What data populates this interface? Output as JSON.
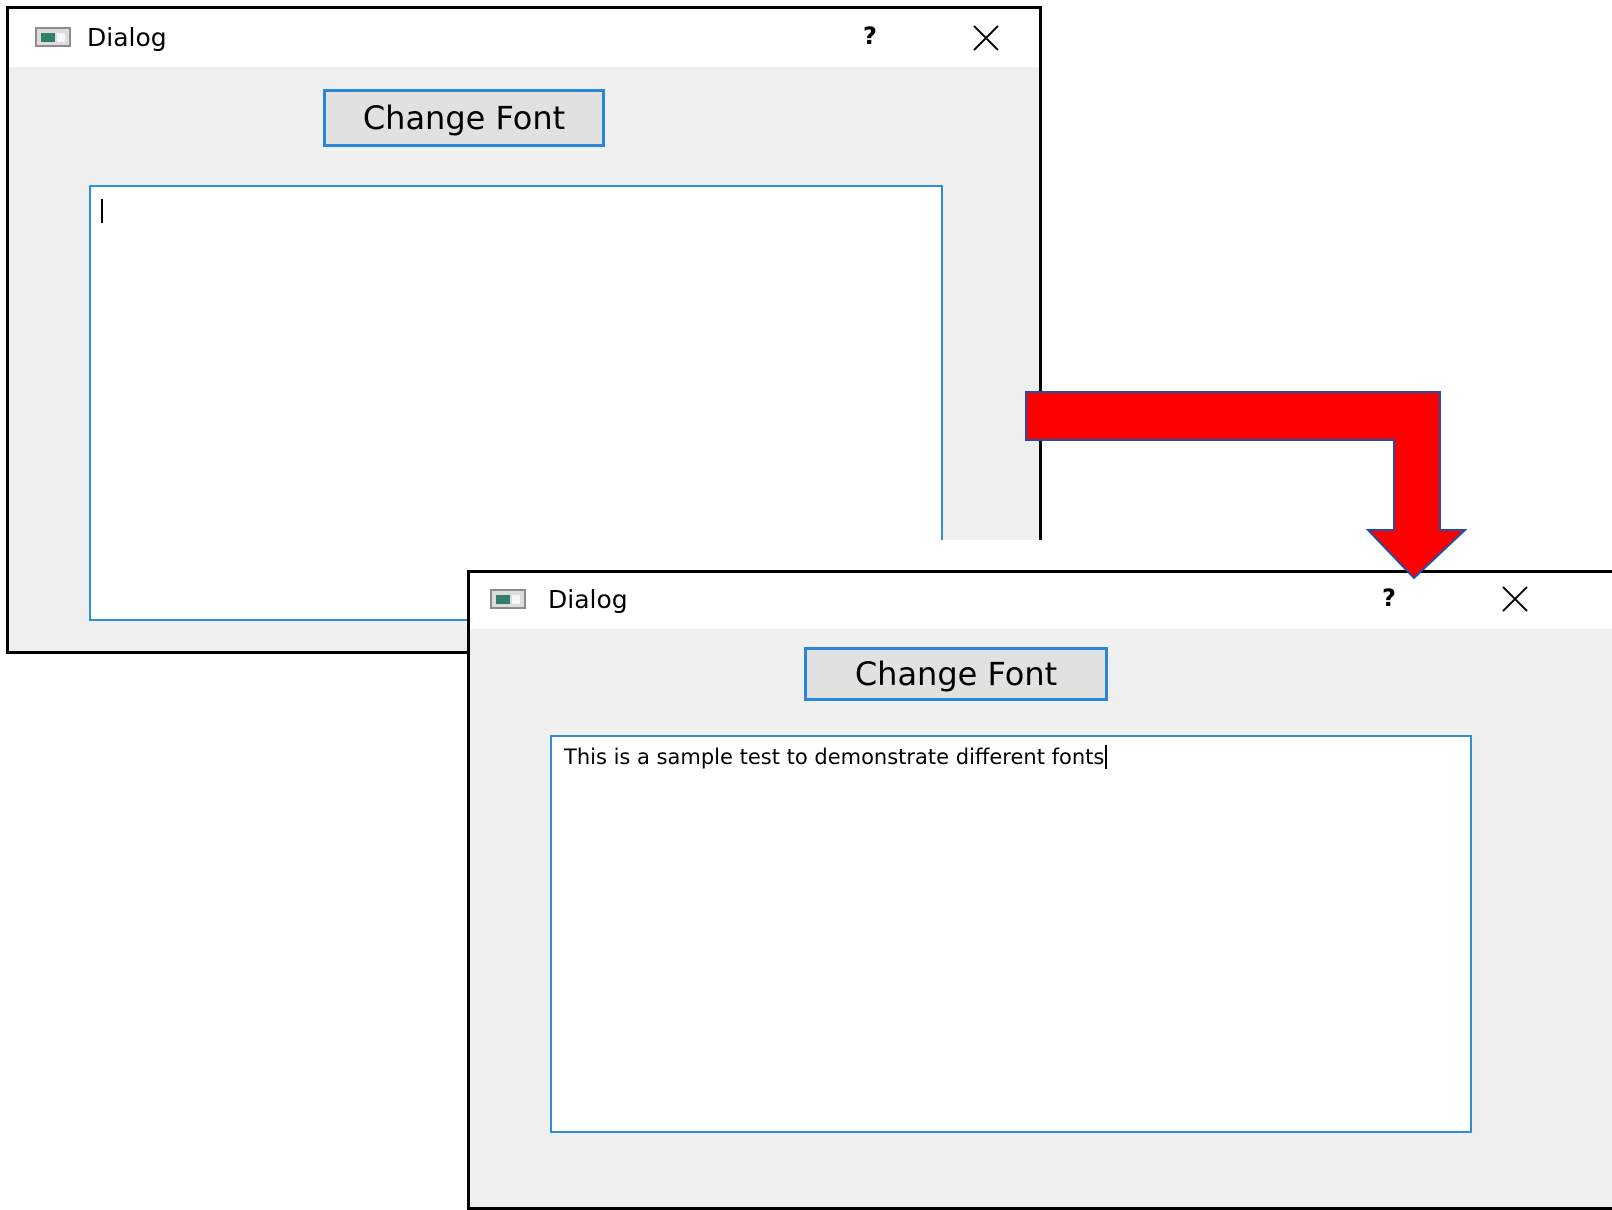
{
  "dialog_before": {
    "title": "Dialog",
    "help_label": "?",
    "button_label": "Change Font",
    "text_value": ""
  },
  "dialog_after": {
    "title": "Dialog",
    "help_label": "?",
    "button_label": "Change Font",
    "text_value": "This is a sample test to demonstrate different fonts"
  },
  "arrow": {
    "color": "#ff0000",
    "outline_color": "#1f4fa8"
  }
}
